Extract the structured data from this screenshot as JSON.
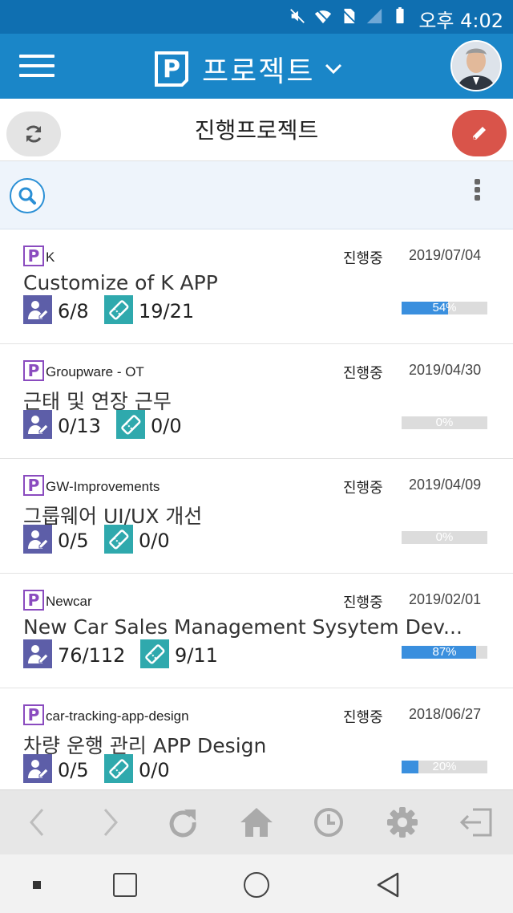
{
  "status_bar": {
    "time": "오후 4:02",
    "icons": [
      "mute-icon",
      "wifi-icon",
      "no-sim-icon",
      "signal-icon",
      "battery-icon"
    ]
  },
  "header": {
    "app_title": "프로젝트",
    "logo_letter": "P"
  },
  "subheader": {
    "title": "진행프로젝트"
  },
  "projects": [
    {
      "code": "K",
      "status": "진행중",
      "date": "2019/07/04",
      "name": "Customize of K APP",
      "members": "6/8",
      "tasks": "19/21",
      "progress_label": "54%",
      "progress": 0.54
    },
    {
      "code": "Groupware - OT",
      "status": "진행중",
      "date": "2019/04/30",
      "name": "근태 및 연장 근무",
      "members": "0/13",
      "tasks": "0/0",
      "progress_label": "0%",
      "progress": 0
    },
    {
      "code": "GW-Improvements",
      "status": "진행중",
      "date": "2019/04/09",
      "name": "그룹웨어 UI/UX 개선",
      "members": "0/5",
      "tasks": "0/0",
      "progress_label": "0%",
      "progress": 0
    },
    {
      "code": "Newcar",
      "status": "진행중",
      "date": "2019/02/01",
      "name": " New Car Sales Management Sysytem Dev...",
      "members": "76/112",
      "tasks": "9/11",
      "progress_label": "87%",
      "progress": 0.87
    },
    {
      "code": "car-tracking-app-design",
      "status": "진행중",
      "date": "2018/06/27",
      "name": "차량 운행 관리 APP Design",
      "members": "0/5",
      "tasks": "0/0",
      "progress_label": "20%",
      "progress": 0.2
    }
  ],
  "colors": {
    "status_bar": "#0f6fb1",
    "app_bar": "#1a86c8",
    "edit_button": "#d9544a",
    "progress_fill": "#3a8fde",
    "member_icon_bg": "#5d5ea8",
    "task_icon_bg": "#2fa9ad",
    "project_badge": "#8a4bbf"
  }
}
